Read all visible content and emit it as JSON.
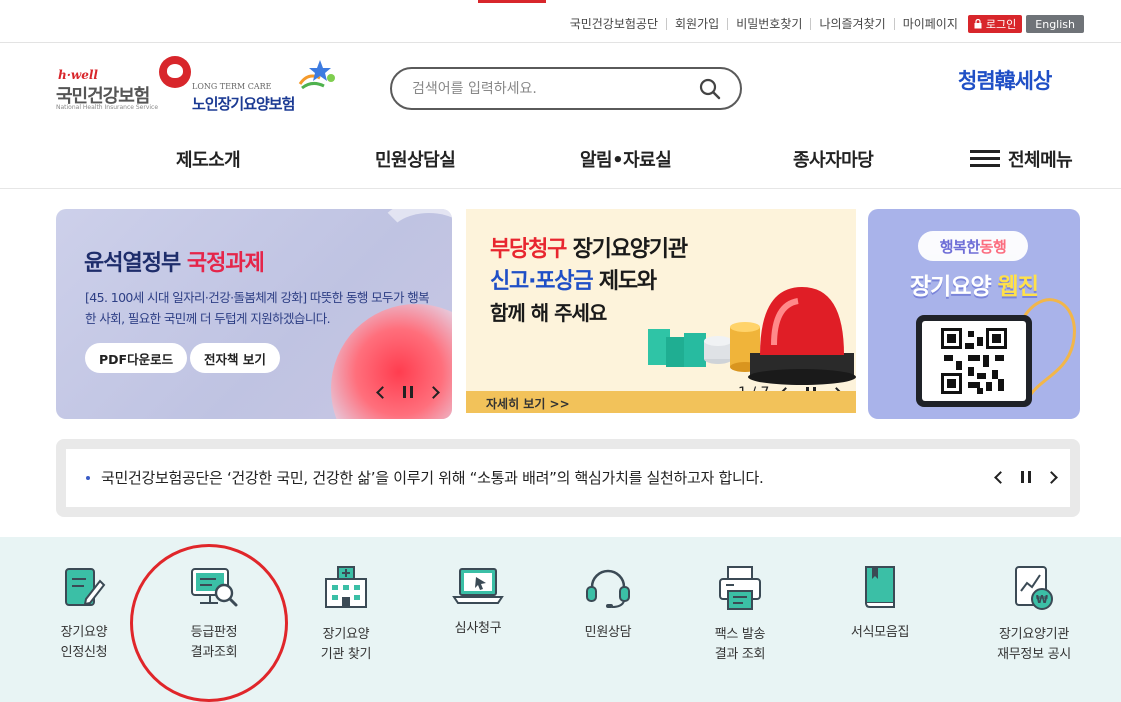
{
  "topbar": {
    "links": [
      "국민건강보험공단",
      "회원가입",
      "비밀번호찾기",
      "나의즐겨찾기",
      "마이페이지"
    ],
    "login_label": "로그인",
    "english_label": "English"
  },
  "header": {
    "nhis_logo": {
      "tagline": "h·well",
      "name": "국민건강보험",
      "english": "National Health Insurance Service"
    },
    "ltc_logo": {
      "english": "LONG TERM CARE",
      "name": "노인장기요양보험"
    },
    "search_placeholder": "검색어를 입력하세요.",
    "campaign_logo": "청렴韓세상"
  },
  "nav": {
    "items": [
      "제도소개",
      "민원상담실",
      "알림•자료실",
      "종사자마당"
    ],
    "all_menu_label": "전체메뉴"
  },
  "banners": {
    "policy": {
      "title_prefix": "윤석열정부 ",
      "title_highlight": "국정과제",
      "desc": "[45. 100세 시대 일자리·건강·돌봄체계 강화] 따뜻한 동행 모두가 행복한 사회, 필요한 국민께 더 두텁게 지원하겠습니다.",
      "pdf_button": "PDF다운로드",
      "ebook_button": "전자책 보기"
    },
    "campaign": {
      "line1_red": "부당청구",
      "line1_rest": " 장기요양기관",
      "line2_blue": "신고·포상금",
      "line2_rest": " 제도와",
      "line3": "함께 해 주세요",
      "more_label": "자세히 보기 >>",
      "page_indicator": "1 / 7"
    },
    "webzine": {
      "tag_prefix": "행복한 ",
      "tag_highlight": "동행",
      "title_main": "장기요양 ",
      "title_highlight": "웹진"
    }
  },
  "notice": {
    "text": "국민건강보험공단은 ‘건강한 국민, 건강한 삶’을 이루기 위해 “소통과 배려”의 핵심가치를 실천하고자 합니다."
  },
  "quick_menu": [
    {
      "icon": "application-pen-icon",
      "line1": "장기요양",
      "line2": "인정신청"
    },
    {
      "icon": "monitor-search-icon",
      "line1": "등급판정",
      "line2": "결과조회"
    },
    {
      "icon": "hospital-building-icon",
      "line1": "장기요양",
      "line2": "기관 찾기"
    },
    {
      "icon": "laptop-cursor-icon",
      "line1": "심사청구",
      "line2": ""
    },
    {
      "icon": "headset-icon",
      "line1": "민원상담",
      "line2": ""
    },
    {
      "icon": "fax-printer-icon",
      "line1": "팩스 발송",
      "line2": "결과 조회"
    },
    {
      "icon": "book-icon",
      "line1": "서식모음집",
      "line2": ""
    },
    {
      "icon": "finance-chart-won-icon",
      "line1": "장기요양기관",
      "line2": "재무정보 공시"
    }
  ],
  "colors": {
    "brand_red": "#d8262b",
    "ltc_blue": "#1b3a93",
    "icon_teal": "#3bbfa6",
    "icon_dark": "#3b4a55",
    "quick_bg": "#e8f4f4"
  }
}
